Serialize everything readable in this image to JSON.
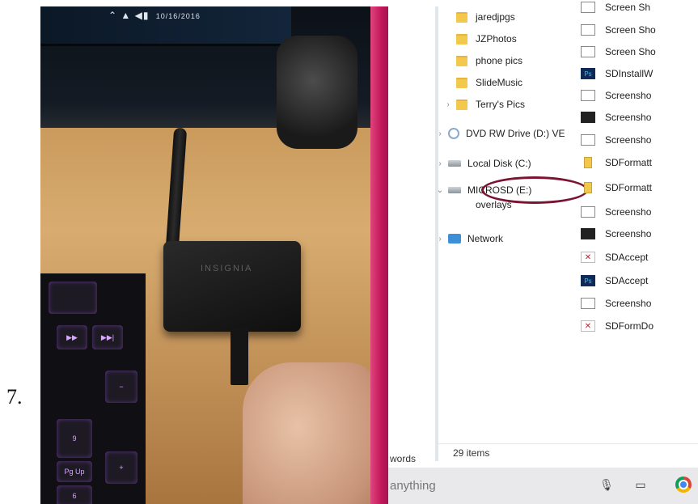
{
  "step": {
    "number": "7."
  },
  "photo": {
    "tray_date": "10/16/2016",
    "reader_brand": "INSIGNIA",
    "keyboard_keys": [
      "▶▶",
      "▶▶|",
      "9",
      "Pg Up",
      "+",
      "−",
      "6"
    ]
  },
  "explorer": {
    "tree": [
      {
        "label": "jaredjpgs",
        "type": "folder"
      },
      {
        "label": "JZPhotos",
        "type": "folder"
      },
      {
        "label": "phone pics",
        "type": "folder"
      },
      {
        "label": "SlideMusic",
        "type": "folder"
      },
      {
        "label": "Terry's Pics",
        "type": "folder",
        "expandable": true
      },
      {
        "label": "DVD RW Drive (D:) VE",
        "type": "dvd",
        "expandable": true
      },
      {
        "label": "Local Disk (C:)",
        "type": "drive",
        "expandable": true
      },
      {
        "label": "MICROSD (E:)",
        "type": "drive",
        "expanded": true,
        "highlighted": true
      },
      {
        "label": "overlays",
        "type": "folder"
      },
      {
        "label": "Network",
        "type": "network",
        "expandable": true
      }
    ],
    "files": [
      {
        "label": "Screen Sh",
        "icon": "image"
      },
      {
        "label": "Screen Sho",
        "icon": "image"
      },
      {
        "label": "Screen Sho",
        "icon": "image"
      },
      {
        "label": "SDInstallW",
        "icon": "ps"
      },
      {
        "label": "Screensho",
        "icon": "image"
      },
      {
        "label": "Screensho",
        "icon": "dark"
      },
      {
        "label": "Screensho",
        "icon": "image"
      },
      {
        "label": "SDFormatt",
        "icon": "zip"
      },
      {
        "label": "SDFormatt",
        "icon": "zip"
      },
      {
        "label": "Screensho",
        "icon": "image"
      },
      {
        "label": "Screensho",
        "icon": "dark"
      },
      {
        "label": "SDAccept",
        "icon": "red"
      },
      {
        "label": "SDAccept",
        "icon": "ps"
      },
      {
        "label": "Screensho",
        "icon": "image"
      },
      {
        "label": "SDFormDo",
        "icon": "red"
      }
    ],
    "status": "29 items",
    "behind_window_text": "words"
  },
  "taskbar": {
    "search_text": "anything",
    "icons": [
      "mic-icon",
      "task-view-icon",
      "chrome-icon"
    ]
  },
  "colors": {
    "highlight_ring": "#7b1432",
    "divider": "#c2185b"
  }
}
